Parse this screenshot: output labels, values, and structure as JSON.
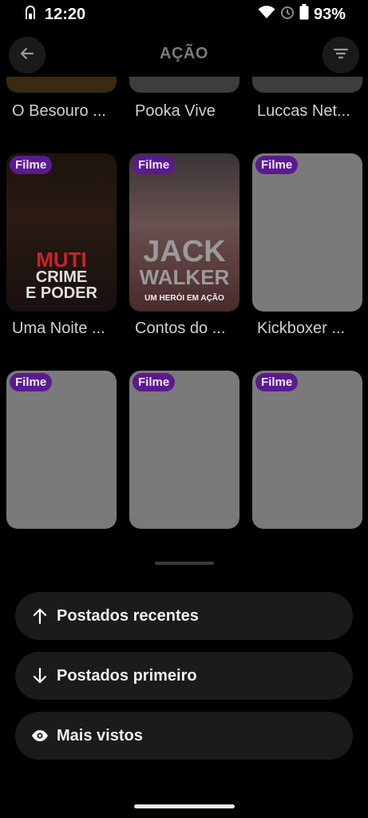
{
  "status_bar": {
    "time": "12:20",
    "battery": "93%",
    "icons": [
      "sim-icon",
      "wifi-icon",
      "alarm-icon",
      "battery-icon"
    ]
  },
  "header": {
    "title": "AÇÃO",
    "back_icon": "arrow-left-icon",
    "filter_icon": "filter-icon"
  },
  "grid": {
    "top_row_titles": [
      "O Besouro ...",
      "Pooka Vive",
      "Luccas Net..."
    ],
    "rows": [
      [
        {
          "badge": "Filme",
          "title": "Uma Noite ...",
          "poster_text": [
            "MUTI",
            "CRIME",
            "E PODER"
          ]
        },
        {
          "badge": "Filme",
          "title": "Contos do ...",
          "poster_text": [
            "JACK",
            "WALKER",
            "UM HERÓI EM AÇÃO"
          ]
        },
        {
          "badge": "Filme",
          "title": "Kickboxer ..."
        }
      ],
      [
        {
          "badge": "Filme"
        },
        {
          "badge": "Filme"
        },
        {
          "badge": "Filme"
        }
      ]
    ]
  },
  "sort_options": [
    {
      "label": "Postados recentes",
      "icon": "arrow-up-icon"
    },
    {
      "label": "Postados primeiro",
      "icon": "arrow-down-icon"
    },
    {
      "label": "Mais vistos",
      "icon": "eye-icon"
    }
  ],
  "colors": {
    "background": "#000000",
    "badge": "#5b1a8f",
    "sheet_button": "#1b1b1b",
    "placeholder": "#7a7a7a"
  }
}
